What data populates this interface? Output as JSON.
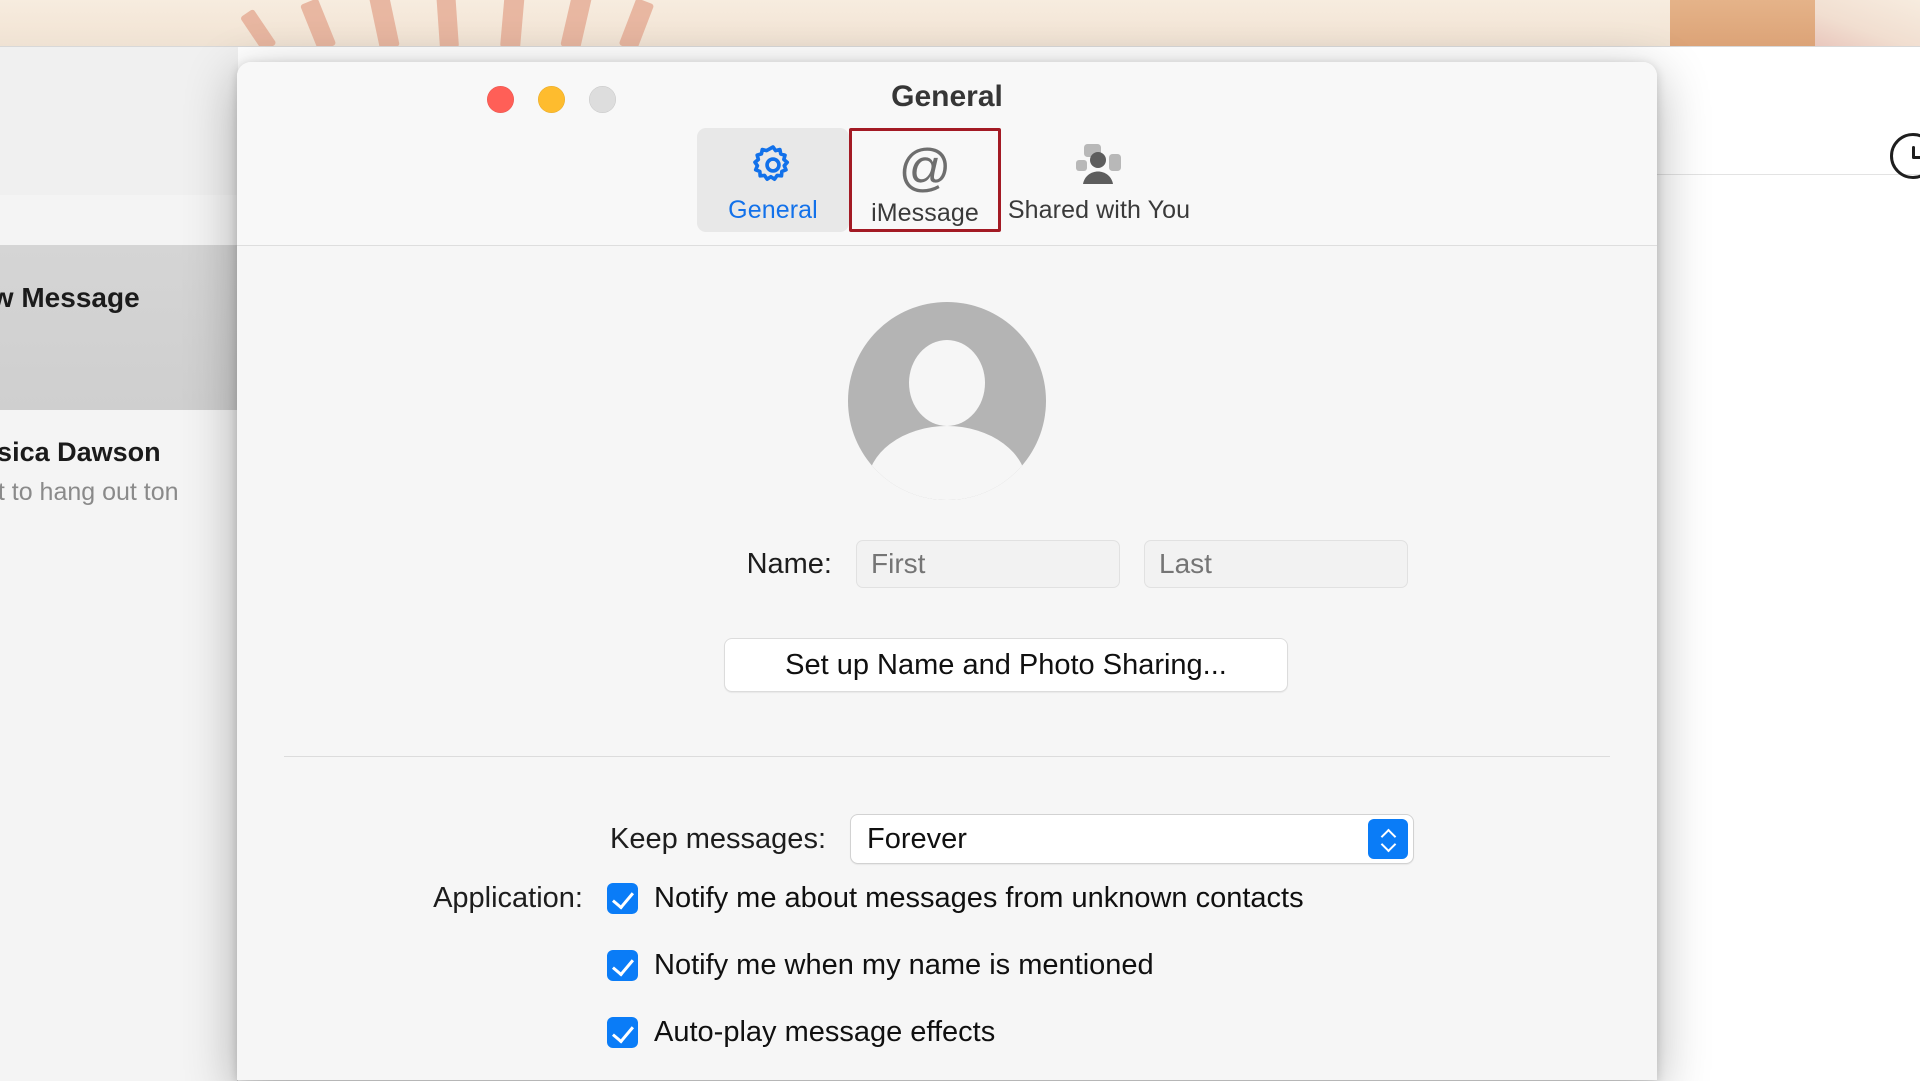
{
  "desktop": {
    "wallpaper_colors": {
      "cream": "#f5e9da",
      "ray": "#e3a68e",
      "tan": "#dca377"
    }
  },
  "messages_app": {
    "sidebar": {
      "selected_item_label": "New Message",
      "conversation": {
        "sender": "Jessica Dawson",
        "preview": "want to hang out ton"
      }
    },
    "toolbar": {
      "icon": "clock-icon"
    }
  },
  "settings_window": {
    "title": "General",
    "traffic_lights": {
      "close": "close-button",
      "minimize": "minimize-button",
      "zoom": "zoom-button",
      "close_color": "#ff5f57",
      "minimize_color": "#febc2e",
      "zoom_color": "#dddddd"
    },
    "tabs": [
      {
        "label": "General",
        "icon": "gear-icon",
        "selected": true,
        "highlighted": false
      },
      {
        "label": "iMessage",
        "icon": "at-sign-icon",
        "selected": false,
        "highlighted": true
      },
      {
        "label": "Shared with You",
        "icon": "shared-with-you-icon",
        "selected": false,
        "highlighted": false
      }
    ],
    "highlight_color": "#a31a24",
    "accent_color": "#0a7cf7",
    "selected_tab_label_color": "#1271ea",
    "content": {
      "avatar": "default-avatar-placeholder",
      "name": {
        "label": "Name:",
        "first_placeholder": "First",
        "first_value": "",
        "last_placeholder": "Last",
        "last_value": ""
      },
      "setup_button_label": "Set up Name and Photo Sharing...",
      "keep_messages": {
        "label": "Keep messages:",
        "value": "Forever"
      },
      "application": {
        "label": "Application:",
        "options": [
          {
            "label": "Notify me about messages from unknown contacts",
            "checked": true
          },
          {
            "label": "Notify me when my name is mentioned",
            "checked": true
          },
          {
            "label": "Auto-play message effects",
            "checked": true
          }
        ]
      }
    }
  }
}
